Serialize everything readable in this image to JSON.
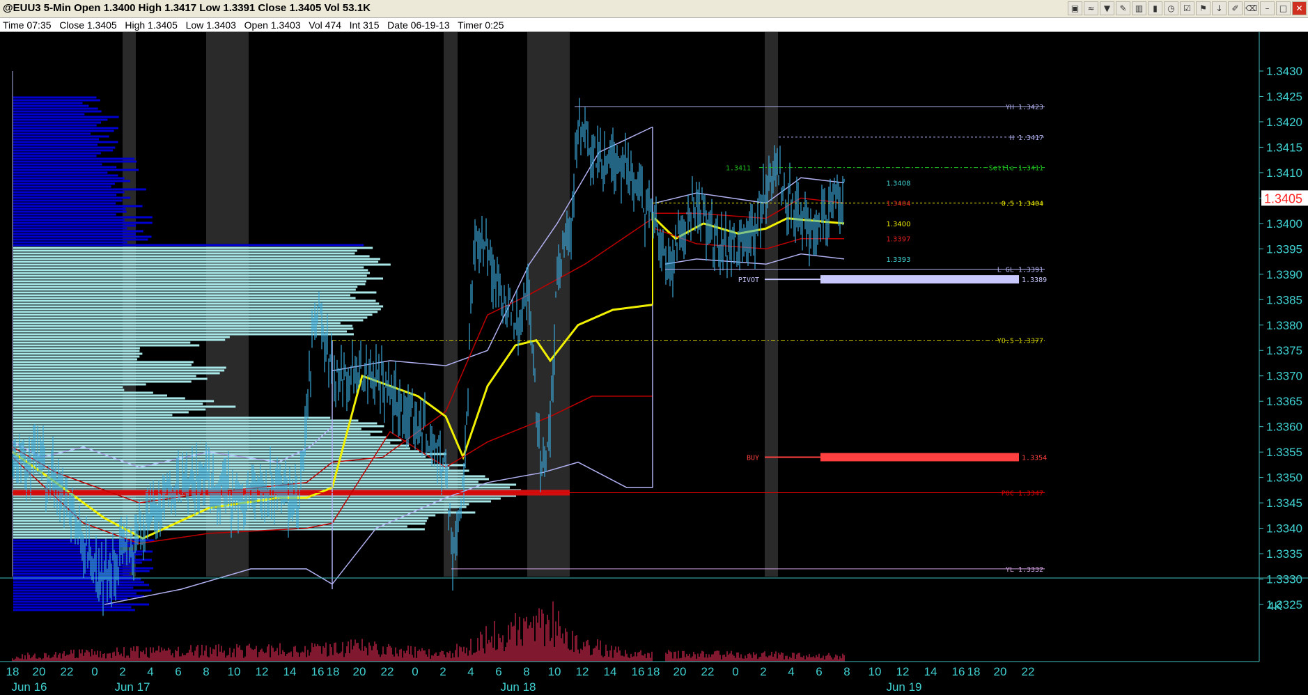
{
  "window": {
    "title": "@EUU3 5-Min Open 1.3400 High 1.3417 Low 1.3391 Close 1.3405 Vol 53.1K",
    "toolbar_icons": [
      "chart-icon",
      "wave-icon",
      "funnel-icon",
      "pencil-icon",
      "bars-icon",
      "candle-icon",
      "clock-icon",
      "checkbox-icon",
      "flag-icon",
      "down-arrow-icon",
      "pen-icon",
      "trash-icon",
      "minimize-icon",
      "restore-icon",
      "close-icon"
    ]
  },
  "info": {
    "time": "Time 07:35",
    "close": "Close 1.3405",
    "high": "High 1.3405",
    "low": "Low 1.3403",
    "open": "Open 1.3403",
    "vol": "Vol 474",
    "int": "Int 315",
    "date": "Date 06-19-13",
    "timer": "Timer 0:25"
  },
  "chart_data": {
    "type": "candlestick",
    "symbol": "@EUU3",
    "interval": "5-Min",
    "price_axis": {
      "ylim": [
        1.3322,
        1.3434
      ],
      "ticks": [
        "1.3325",
        "1.3330",
        "1.3335",
        "1.3340",
        "1.3345",
        "1.3350",
        "1.3355",
        "1.3360",
        "1.3365",
        "1.3370",
        "1.3375",
        "1.3380",
        "1.3385",
        "1.3390",
        "1.3395",
        "1.3400",
        "1.3405",
        "1.3410",
        "1.3415",
        "1.3420",
        "1.3425",
        "1.3430"
      ],
      "last_price": "1.3405",
      "last_color": "#ff2020"
    },
    "time_axis": {
      "hour_labels": [
        "18",
        "20",
        "22",
        "0",
        "2",
        "4",
        "6",
        "8",
        "10",
        "12",
        "14",
        "16",
        "18",
        "20",
        "22",
        "0",
        "2",
        "4",
        "6",
        "8",
        "10",
        "12",
        "14",
        "16",
        "18",
        "20",
        "22",
        "0",
        "2",
        "4",
        "6",
        "8",
        "10",
        "12",
        "14",
        "16",
        "18",
        "20",
        "22"
      ],
      "day_labels": [
        "Jun 16",
        "Jun 17",
        "Jun 18",
        "Jun 19"
      ]
    },
    "levels": [
      {
        "label": "YH 1.3423",
        "price": 1.3423,
        "color": "#b0b0f0",
        "style": "solid"
      },
      {
        "label": "H 1.3417",
        "price": 1.3417,
        "color": "#b0b0f0",
        "style": "dash"
      },
      {
        "label": "Settle 1.3411",
        "price": 1.3411,
        "color": "#20c020",
        "style": "dashdot"
      },
      {
        "label": "0.5 1.3404",
        "price": 1.3404,
        "color": "#f0f000",
        "style": "dash"
      },
      {
        "label": "L GL 1.3391",
        "price": 1.3391,
        "color": "#b0b0f0",
        "style": "solid"
      },
      {
        "label": "YO.5 1.3377",
        "price": 1.3377,
        "color": "#d0d000",
        "style": "dashdot"
      },
      {
        "label": "YL 1.3332",
        "price": 1.3332,
        "color": "#d0a0e0",
        "style": "solid"
      },
      {
        "label": "POC 1.3347",
        "price": 1.3347,
        "color": "#e00000",
        "style": "solid"
      }
    ],
    "zones": [
      {
        "label": "PIVOT",
        "value": "1.3389",
        "price": 1.3389,
        "color": "#c8c8ff"
      },
      {
        "label": "BUY",
        "value": "1.3354",
        "price": 1.3354,
        "color": "#ff4040"
      }
    ],
    "band_labels": [
      {
        "text": "1.3408",
        "price": 1.3408,
        "color": "#40d0d0"
      },
      {
        "text": "1.3404",
        "price": 1.3404,
        "color": "#e02020"
      },
      {
        "text": "1.3400",
        "price": 1.34,
        "color": "#f0f000"
      },
      {
        "text": "1.3397",
        "price": 1.3397,
        "color": "#e02020"
      },
      {
        "text": "1.3393",
        "price": 1.3393,
        "color": "#40d0d0"
      }
    ],
    "settle_left_label": "1.3411",
    "volume_axis_label": "4K",
    "colors": {
      "bars": "#3aa8d8",
      "vwap": "#f0f000",
      "bands": "#c00000",
      "outer": "#b8b8f0",
      "profile_light": "#a8e8e8",
      "profile_dark": "#0000d0",
      "volume": "#ff3060"
    }
  }
}
